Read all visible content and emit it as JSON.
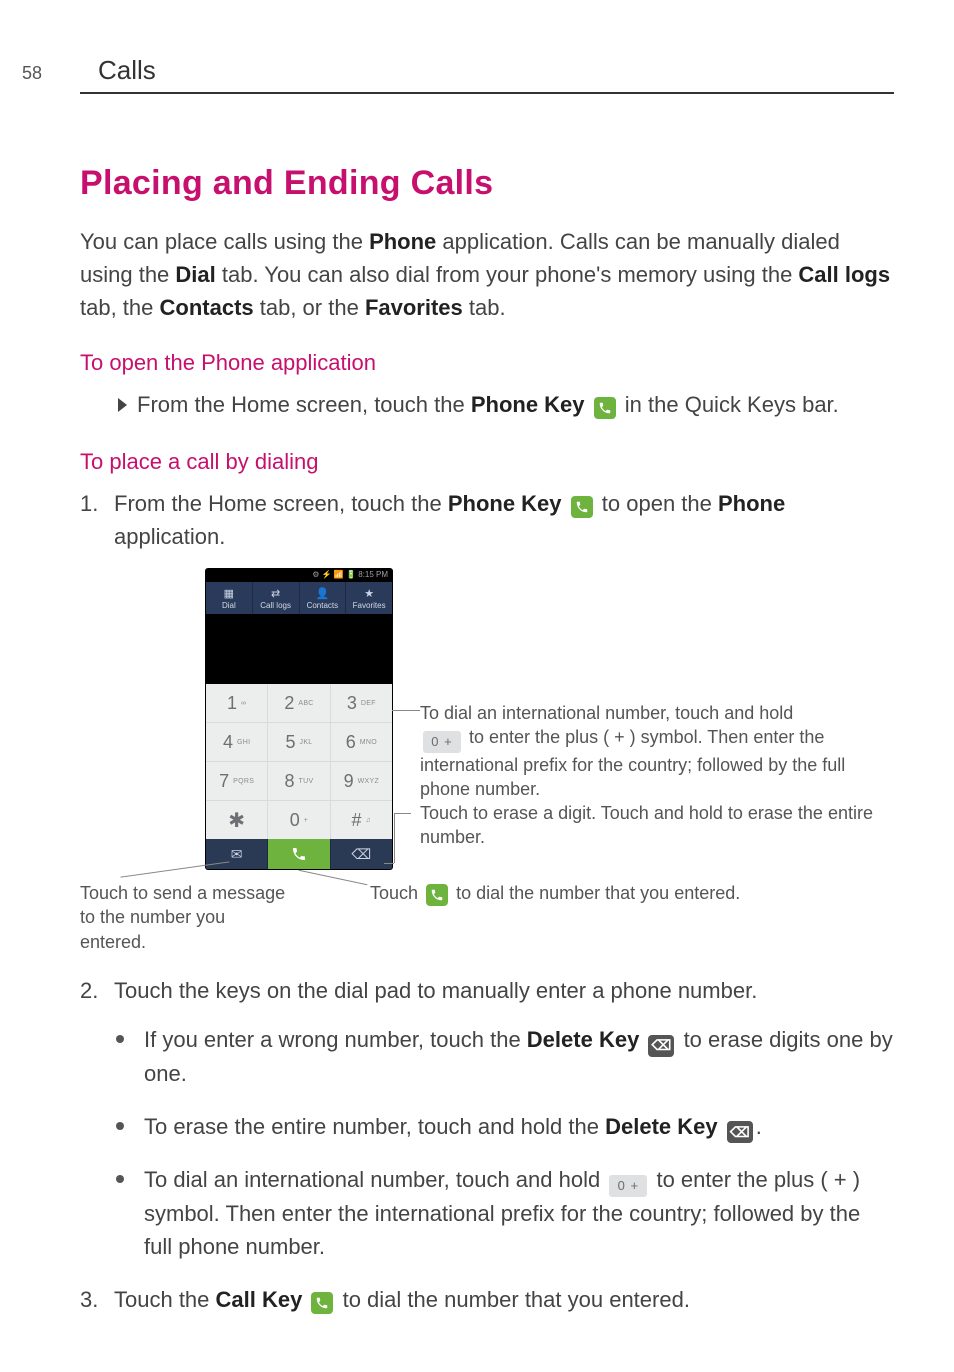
{
  "header": {
    "page_number": "58",
    "section": "Calls"
  },
  "title": "Placing and Ending Calls",
  "intro": {
    "t1": "You can place calls using the ",
    "phone": "Phone",
    "t2": " application. Calls can be manually dialed using the ",
    "dial": "Dial",
    "t3": " tab. You can also dial from your phone's memory using the ",
    "calllogs": "Call logs",
    "t4": " tab, the ",
    "contacts": "Contacts",
    "t5": " tab, or the ",
    "favorites": "Favorites",
    "t6": " tab."
  },
  "sec1": {
    "heading": "To open the Phone application",
    "line_a": "From the Home screen, touch the ",
    "phone_key": "Phone Key",
    "line_b": " in the Quick Keys bar."
  },
  "sec2": {
    "heading": "To place a call by dialing",
    "step1_a": "From the Home screen, touch the ",
    "phone_key": "Phone Key",
    "step1_b": " to open the ",
    "phone": "Phone",
    "step1_c": " application."
  },
  "phone_ui": {
    "status": "⚙ ⚡ 📶 🔋 8:15 PM",
    "tabs": {
      "dial": "Dial",
      "calllogs": "Call logs",
      "contacts": "Contacts",
      "favorites": "Favorites"
    },
    "keys": {
      "k1": {
        "n": "1",
        "s": "∞"
      },
      "k2": {
        "n": "2",
        "s": "ABC"
      },
      "k3": {
        "n": "3",
        "s": "DEF"
      },
      "k4": {
        "n": "4",
        "s": "GHI"
      },
      "k5": {
        "n": "5",
        "s": "JKL"
      },
      "k6": {
        "n": "6",
        "s": "MNO"
      },
      "k7": {
        "n": "7",
        "s": "PQRS"
      },
      "k8": {
        "n": "8",
        "s": "TUV"
      },
      "k9": {
        "n": "9",
        "s": "WXYZ"
      },
      "kstar": {
        "n": "✱",
        "s": ""
      },
      "k0": {
        "n": "0",
        "s": "+"
      },
      "khash": {
        "n": "#",
        "s": "♫"
      }
    }
  },
  "callouts": {
    "intl_a": "To dial an international number, touch and hold ",
    "intl_b": " to enter the plus ( + ) symbol. Then enter the international prefix for the country; followed by the full phone number.",
    "erase": "Touch to erase a digit. Touch and hold to erase the entire number.",
    "dialnum_a": "Touch ",
    "dialnum_b": " to dial the number that you entered.",
    "sendmsg": "Touch to send a message to the number you entered."
  },
  "steps_after": {
    "step2": "Touch the keys on the dial pad to manually enter a phone number.",
    "b1_a": "If you enter a wrong number, touch the ",
    "delete_key": "Delete Key",
    "b1_b": " to erase digits one by one.",
    "b2_a": "To erase the entire number, touch and hold the ",
    "b2_b": ".",
    "b3_a": "To dial an international number, touch and hold ",
    "b3_b": " to enter the plus ( + ) symbol. Then enter the international prefix for the country; followed by the full phone number.",
    "step3_a": "Touch the ",
    "call_key": "Call Key",
    "step3_b": " to dial the number that you entered."
  },
  "icon_labels": {
    "zero_plus": "0 +",
    "backspace": "⌫"
  }
}
